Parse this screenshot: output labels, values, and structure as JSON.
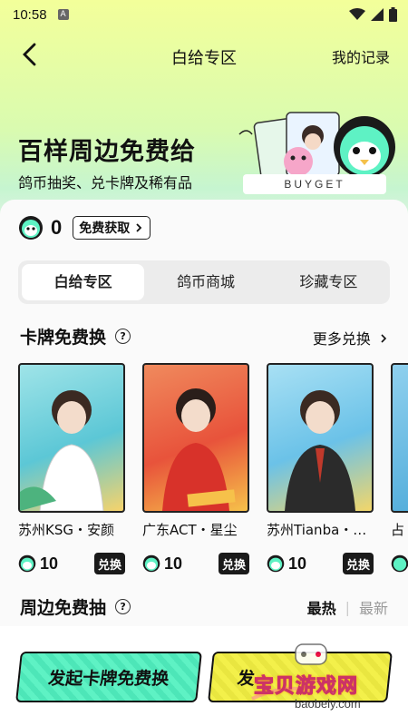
{
  "status_bar": {
    "time": "10:58",
    "badge": "A"
  },
  "nav": {
    "title": "白给专区",
    "record": "我的记录"
  },
  "hero": {
    "title": "百样周边免费给",
    "subtitle": "鸽币抽奖、兑卡牌及稀有品",
    "brand": "BUYGET"
  },
  "wallet": {
    "coins": "0",
    "free_get": "免费获取"
  },
  "tabs": [
    {
      "label": "白给专区",
      "active": true
    },
    {
      "label": "鸽币商城",
      "active": false
    },
    {
      "label": "珍藏专区",
      "active": false
    }
  ],
  "cards_section": {
    "title": "卡牌免费换",
    "more": "更多兑换"
  },
  "cards": [
    {
      "name": "苏州KSG・安颜",
      "price": "10",
      "action": "兑换",
      "bg": "#5cc7d6"
    },
    {
      "name": "广东ACT・星尘",
      "price": "10",
      "action": "兑换",
      "bg": "#e8533b"
    },
    {
      "name": "苏州Tianba・…",
      "price": "10",
      "action": "兑换",
      "bg": "#6bc2e8"
    },
    {
      "name": "占",
      "price": "",
      "action": "",
      "bg": "#4aa8d8"
    }
  ],
  "merch_section": {
    "title": "周边免费抽",
    "sort_hot": "最热",
    "sort_new": "最新"
  },
  "bottom": {
    "primary": "发起卡牌免费换",
    "secondary": "发"
  },
  "watermark": {
    "text": "宝贝游戏网",
    "url": "baobeiy.com"
  },
  "colors": {
    "accent_green": "#5ef2c4",
    "accent_yellow": "#f3f04a"
  }
}
